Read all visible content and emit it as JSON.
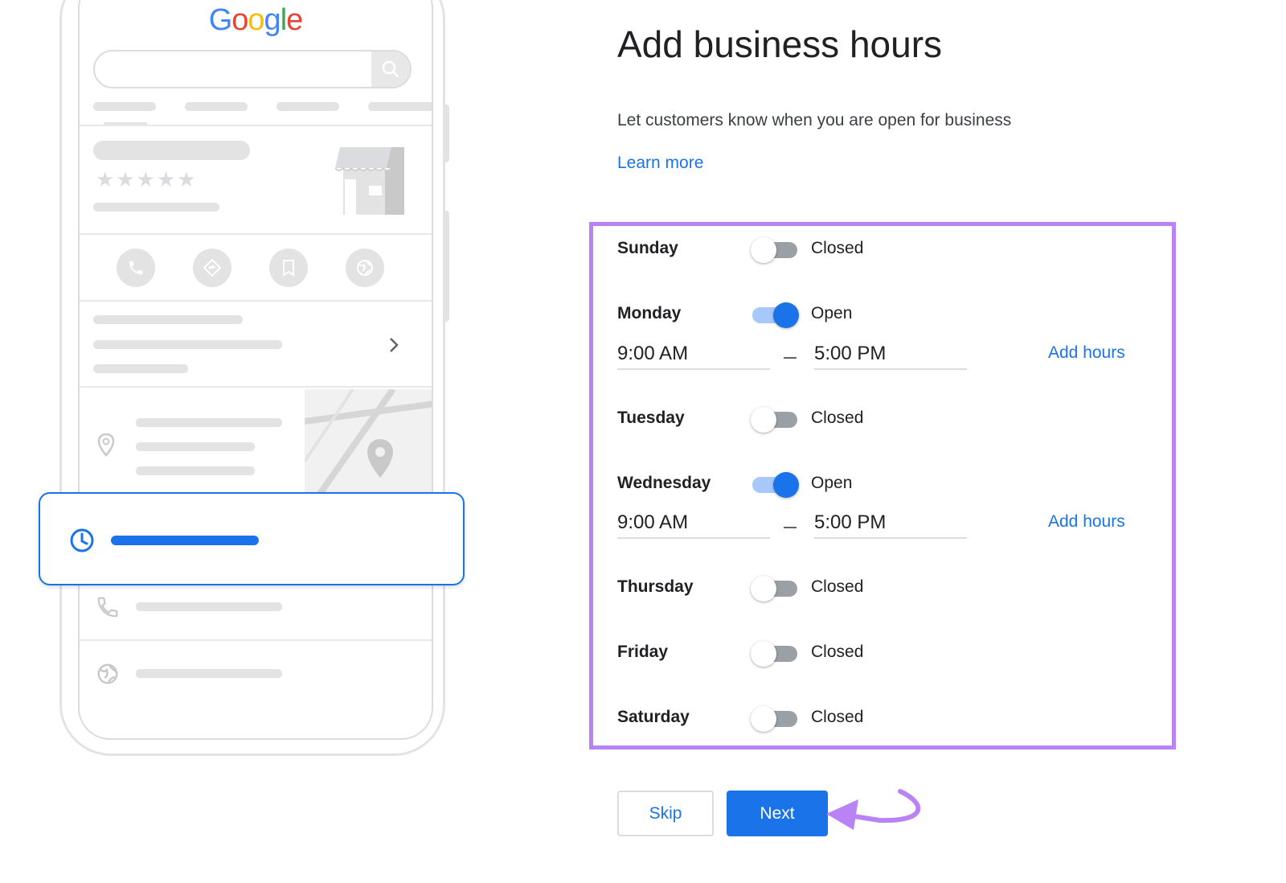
{
  "phone": {
    "logo_letters": [
      "G",
      "o",
      "o",
      "g",
      "l",
      "e"
    ]
  },
  "form": {
    "title": "Add business hours",
    "subtitle": "Let customers know when you are open for business",
    "learn_more": "Learn more",
    "days": [
      {
        "name": "Sunday",
        "open": false,
        "status": "Closed"
      },
      {
        "name": "Monday",
        "open": true,
        "status": "Open",
        "from": "9:00 AM",
        "to": "5:00 PM",
        "add_hours": "Add hours"
      },
      {
        "name": "Tuesday",
        "open": false,
        "status": "Closed"
      },
      {
        "name": "Wednesday",
        "open": true,
        "status": "Open",
        "from": "9:00 AM",
        "to": "5:00 PM",
        "add_hours": "Add hours"
      },
      {
        "name": "Thursday",
        "open": false,
        "status": "Closed"
      },
      {
        "name": "Friday",
        "open": false,
        "status": "Closed"
      },
      {
        "name": "Saturday",
        "open": false,
        "status": "Closed"
      }
    ],
    "skip_label": "Skip",
    "next_label": "Next"
  },
  "colors": {
    "accent": "#1a73e8",
    "highlight": "#b983f5"
  }
}
